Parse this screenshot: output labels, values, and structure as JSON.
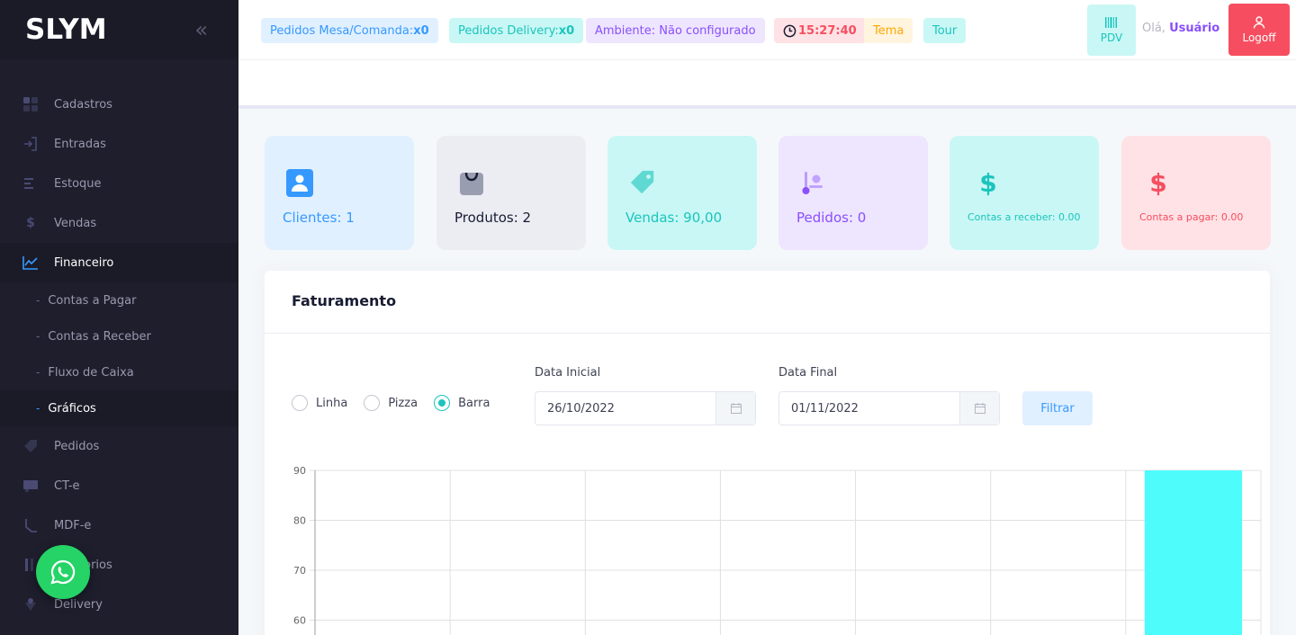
{
  "sidebar": {
    "logo": "SLYM",
    "items": [
      {
        "label": "Cadastros",
        "icon": "grid-icon"
      },
      {
        "label": "Entradas",
        "icon": "sign-in-icon"
      },
      {
        "label": "Estoque",
        "icon": "list-icon"
      },
      {
        "label": "Vendas",
        "icon": "dollar-icon"
      },
      {
        "label": "Financeiro",
        "icon": "line-chart-icon"
      }
    ],
    "subitems": [
      "Contas a Pagar",
      "Contas a Receber",
      "Fluxo de Caixa",
      "Gráficos"
    ],
    "items_after": [
      {
        "label": "Pedidos",
        "icon": "tag-icon"
      },
      {
        "label": "CT-e",
        "icon": "truck-icon"
      },
      {
        "label": "MDF-e",
        "icon": "route-icon"
      },
      {
        "label": "Relatorios",
        "icon": "bar-icon"
      },
      {
        "label": "Delivery",
        "icon": "delivery-icon"
      }
    ]
  },
  "header": {
    "mesa_label": "Pedidos Mesa/Comanda:",
    "mesa_count": "x0",
    "delivery_label": "Pedidos Delivery:",
    "delivery_count": "x0",
    "ambiente": "Ambiente: Não configurado",
    "clock": "15:27:40",
    "tema": "Tema",
    "tour": "Tour",
    "pdv": "PDV",
    "greeting": "Olá,",
    "user": "Usuário",
    "logoff": "Logoff"
  },
  "cards": {
    "clientes": "Clientes: 1",
    "produtos": "Produtos: 2",
    "vendas": "Vendas: 90,00",
    "pedidos": "Pedidos: 0",
    "receber": "Contas a receber: 0.00",
    "pagar": "Contas a pagar: 0.00"
  },
  "panel": {
    "title": "Faturamento",
    "radio_options": [
      "Linha",
      "Pizza",
      "Barra"
    ],
    "selected": "Barra",
    "data_inicial_label": "Data Inicial",
    "data_inicial": "26/10/2022",
    "data_final_label": "Data Final",
    "data_final": "01/11/2022",
    "filtrar": "Filtrar"
  },
  "colors": {
    "accent_blue": "#3699ff",
    "accent_teal": "#1bc5bd",
    "accent_purple": "#8950fc",
    "accent_red": "#f64e60",
    "bar": "#4efcfc"
  },
  "chart_data": {
    "type": "bar",
    "visible_yticks": [
      90,
      80,
      70,
      60
    ],
    "series": [
      {
        "values": [
          0,
          0,
          0,
          0,
          0,
          0,
          90
        ]
      }
    ],
    "categories_count": 7,
    "grid": true
  }
}
